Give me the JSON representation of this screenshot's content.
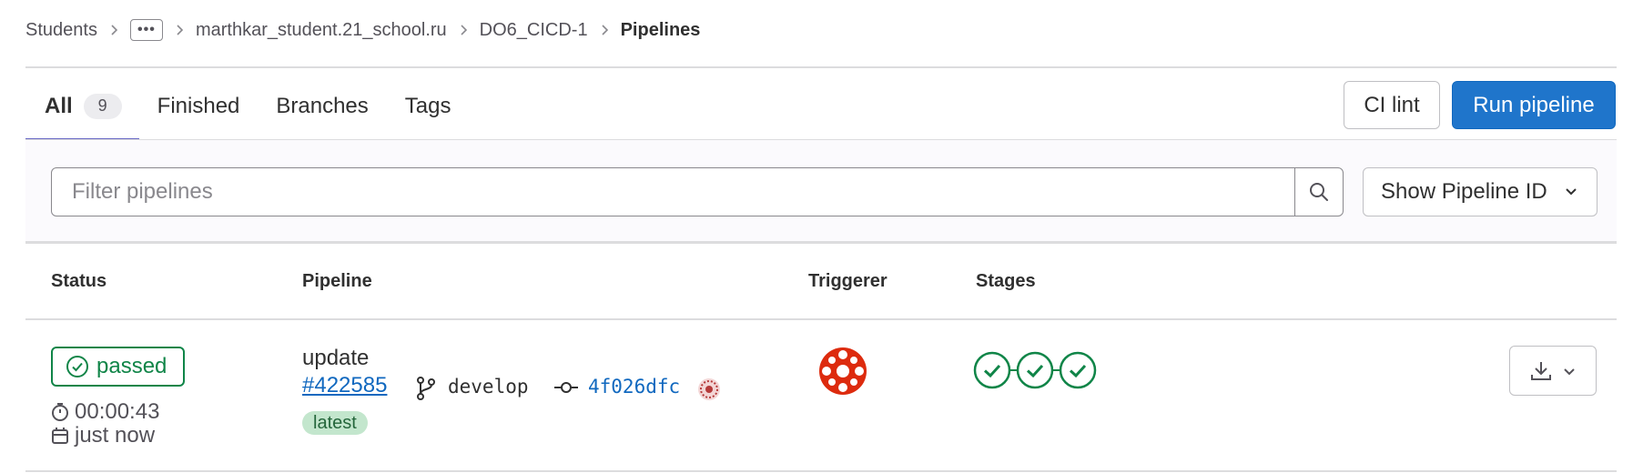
{
  "breadcrumb": {
    "items": [
      "Students",
      "marthkar_student.21_school.ru",
      "DO6_CICD-1"
    ],
    "current": "Pipelines",
    "ellipsis": "•••"
  },
  "tabs": [
    {
      "label": "All",
      "count": "9",
      "active": true
    },
    {
      "label": "Finished"
    },
    {
      "label": "Branches"
    },
    {
      "label": "Tags"
    }
  ],
  "actions": {
    "ci_lint": "CI lint",
    "run_pipeline": "Run pipeline"
  },
  "filter": {
    "placeholder": "Filter pipelines",
    "id_select": "Show Pipeline ID"
  },
  "table": {
    "headers": {
      "status": "Status",
      "pipeline": "Pipeline",
      "triggerer": "Triggerer",
      "stages": "Stages"
    },
    "rows": [
      {
        "status": "passed",
        "duration": "00:00:43",
        "finished": "just now",
        "title": "update",
        "id": "#422585",
        "branch": "develop",
        "commit": "4f026dfc",
        "badge": "latest",
        "stages": [
          "passed",
          "passed",
          "passed"
        ]
      }
    ]
  },
  "colors": {
    "primary": "#1f75cb",
    "success": "#108548",
    "link": "#1068bf",
    "tab_underline": "#6666c4",
    "avatar": "#dd2b0e"
  },
  "icons": [
    "chevron-right-icon",
    "search-icon",
    "chevron-down-icon",
    "status-success-icon",
    "clock-icon",
    "calendar-icon",
    "branch-icon",
    "commit-icon",
    "download-icon"
  ]
}
